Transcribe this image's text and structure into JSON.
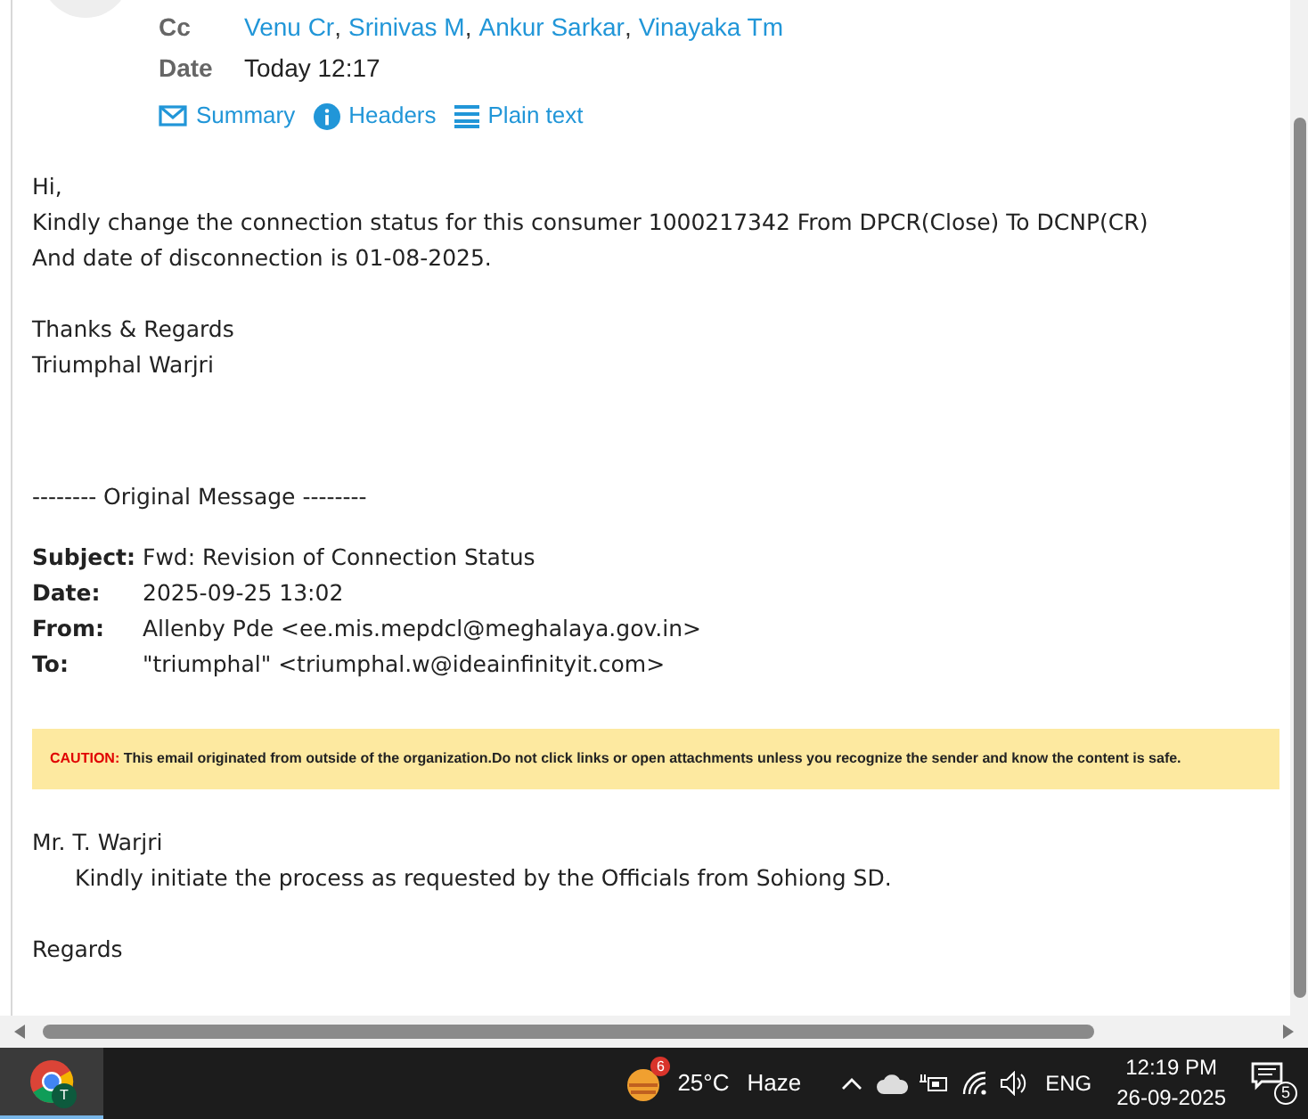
{
  "header": {
    "fields": [
      {
        "label": "Cc",
        "kind": "links",
        "separator": ",",
        "value": [
          "Venu Cr",
          "Srinivas M",
          "Ankur Sarkar",
          "Vinayaka Tm"
        ]
      },
      {
        "label": "Date",
        "kind": "text",
        "value": "Today 12:17"
      }
    ],
    "views": [
      {
        "label": "Summary",
        "kind": "summary"
      },
      {
        "label": "Headers",
        "kind": "headers"
      },
      {
        "label": "Plain text",
        "kind": "plain"
      }
    ]
  },
  "body": {
    "paragraphs": [
      [
        "Hi,",
        "Kindly change the connection status for this consumer 1000217342 From DPCR(Close) To DCNP(CR)",
        "And date of disconnection is 01-08-2025."
      ],
      [
        "Thanks & Regards",
        "Triumphal Warjri"
      ]
    ],
    "separator": "-------- Original Message --------",
    "original_headers": [
      {
        "label": "Subject:",
        "value": "Fwd: Revision of Connection Status"
      },
      {
        "label": "Date:",
        "value": "2025-09-25 13:02"
      },
      {
        "label": "From:",
        "value": "Allenby Pde <ee.mis.mepdcl@meghalaya.gov.in>"
      },
      {
        "label": "To:",
        "value": "\"triumphal\" <triumphal.w@ideainfinityit.com>"
      }
    ],
    "caution": {
      "label": "CAUTION:",
      "text": "This email originated from outside of the organization.Do not click links or open attachments unless you recognize the sender and know the content is safe."
    },
    "quoted": [
      [
        {
          "text": "Mr. T. Warjri",
          "indented": false
        },
        {
          "text": "Kindly initiate the process as requested by the Officials from Sohiong SD.",
          "indented": true
        }
      ],
      [
        {
          "text": "Regards",
          "indented": false
        }
      ]
    ]
  },
  "taskbar": {
    "weather_badge": "6",
    "temperature": "25°C",
    "condition": "Haze",
    "language": "ENG",
    "time": "12:19 PM",
    "date": "26-09-2025",
    "notifications": "5",
    "chrome_letter": "T"
  }
}
